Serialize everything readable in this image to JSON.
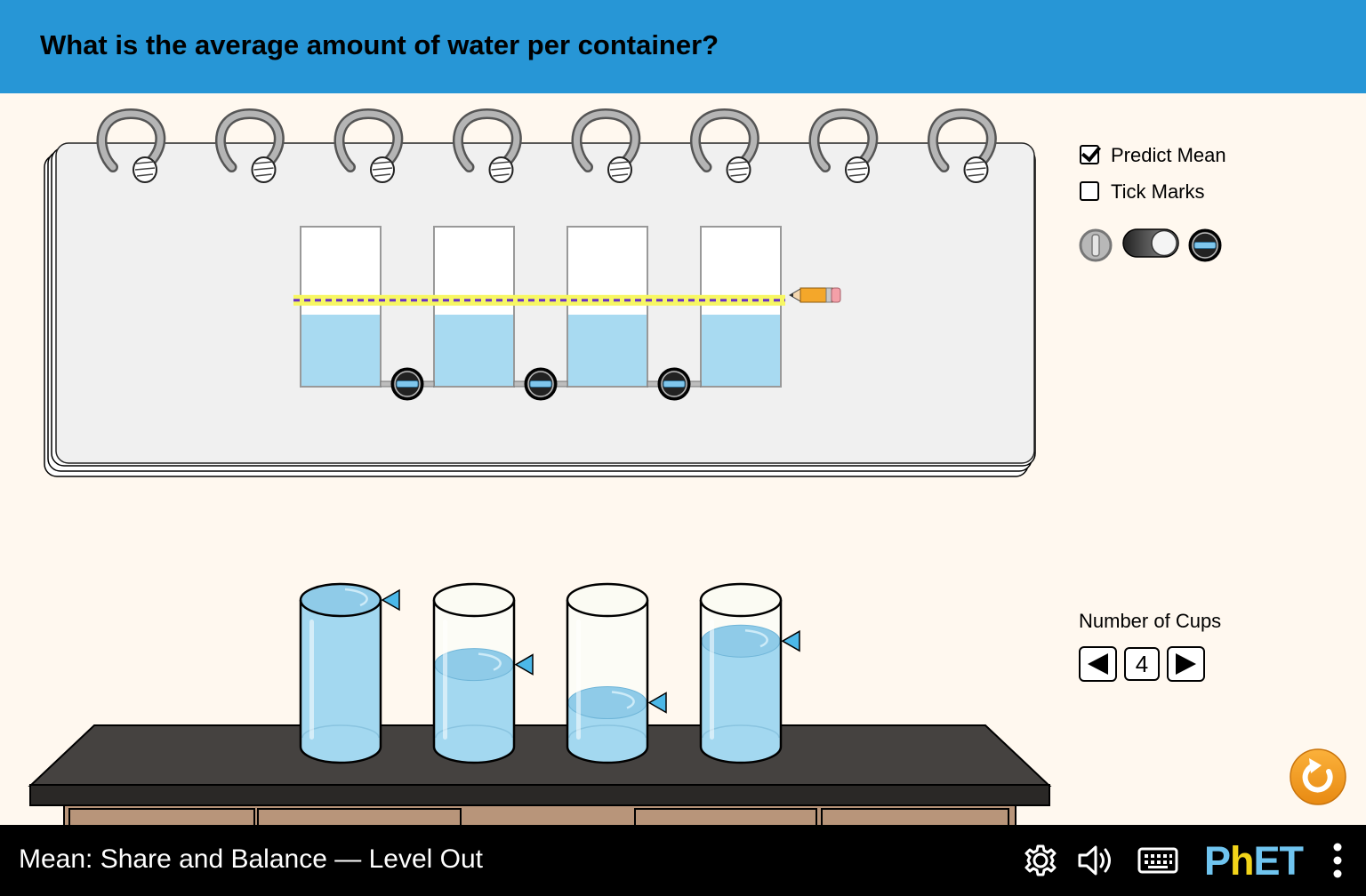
{
  "header": {
    "question": "What is the average amount of water per container?",
    "background_color": "#2796d6"
  },
  "notepad": {
    "ring_count": 8,
    "cups": [
      {
        "fill_fraction": 0.45
      },
      {
        "fill_fraction": 0.45
      },
      {
        "fill_fraction": 0.45
      },
      {
        "fill_fraction": 0.45
      }
    ],
    "valves": [
      {
        "icon": "valve-closed-icon"
      },
      {
        "icon": "valve-closed-icon"
      },
      {
        "icon": "valve-closed-icon"
      }
    ],
    "predict_mean_fraction": 0.54,
    "predict_line_color": "#6a33c4",
    "predict_highlight_color": "#f7f763",
    "water_color": "#a8daf1"
  },
  "controls": {
    "predict_mean": {
      "label": "Predict Mean",
      "checked": true
    },
    "tick_marks": {
      "label": "Tick Marks",
      "checked": false
    },
    "pipe_toggle": {
      "left_icon": "valve-open-icon",
      "right_icon": "valve-closed-icon",
      "state": "right"
    },
    "number_of_cups": {
      "label": "Number of Cups",
      "value": "4"
    }
  },
  "table_cups": [
    {
      "fill_fraction": 1.0
    },
    {
      "fill_fraction": 0.56
    },
    {
      "fill_fraction": 0.3
    },
    {
      "fill_fraction": 0.72
    }
  ],
  "footer": {
    "sim_title": "Mean: Share and Balance — Level Out",
    "logo_p": "P",
    "logo_h": "h",
    "logo_et": "ET",
    "icons": [
      "gear-icon",
      "speaker-icon",
      "keyboard-icon",
      "kebab-menu-icon"
    ]
  },
  "accent_colors": {
    "reset_button": "#f39b1c",
    "table_top": "#454240",
    "cabinet": "#b8957a"
  }
}
